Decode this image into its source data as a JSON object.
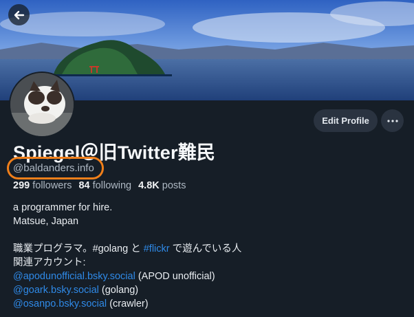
{
  "profile": {
    "display_name": "Spiegel＠旧Twitter難民",
    "handle": "@baldanders.info",
    "followers_count": "299",
    "followers_label": "followers",
    "following_count": "84",
    "following_label": "following",
    "posts_count": "4.8K",
    "posts_label": "posts"
  },
  "actions": {
    "edit_profile_label": "Edit Profile",
    "more_label": "…"
  },
  "bio": {
    "line1": "a programmer for hire.",
    "line2": "Matsue, Japan",
    "line3_pre": "職業プログラマ。#golang と ",
    "line3_link": "#flickr",
    "line3_post": " で遊んでいる人",
    "line4": "関連アカウント:",
    "accounts": [
      {
        "link": "@apodunofficial.bsky.social",
        "note": " (APOD unofficial)"
      },
      {
        "link": "@goark.bsky.social",
        "note": " (golang)"
      },
      {
        "link": "@osanpo.bsky.social",
        "note": " (crawler)"
      }
    ]
  },
  "icons": {
    "back": "arrow-left-icon",
    "more": "ellipsis-icon"
  },
  "colors": {
    "background": "#161e27",
    "link": "#2f8ae8",
    "highlight_ring": "#f07f1a"
  }
}
